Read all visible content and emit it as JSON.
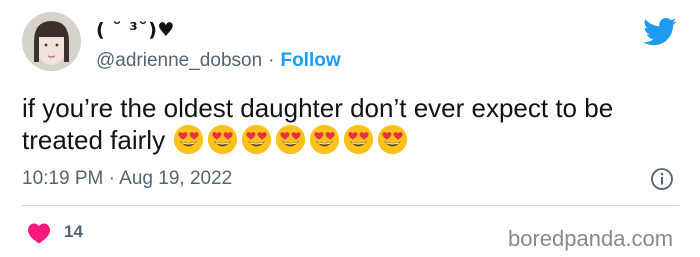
{
  "user": {
    "display_name": "( ˘ ³˘)♥",
    "handle": "@adrienne_dobson",
    "separator": "·",
    "follow_label": "Follow"
  },
  "tweet": {
    "text": "if you’re the oldest daughter don’t ever expect to be treated fairly",
    "emoji_count": 7,
    "emoji_name": "smiling-face-with-heart-eyes",
    "time": "10:19 PM",
    "date_separator": "·",
    "date": "Aug 19, 2022"
  },
  "stats": {
    "likes": "14"
  },
  "watermark": "boredpanda.com",
  "colors": {
    "twitter_blue": "#1d9bf0",
    "heart_red": "#f91880",
    "text_dark": "#0f1419",
    "text_muted": "#536471"
  }
}
